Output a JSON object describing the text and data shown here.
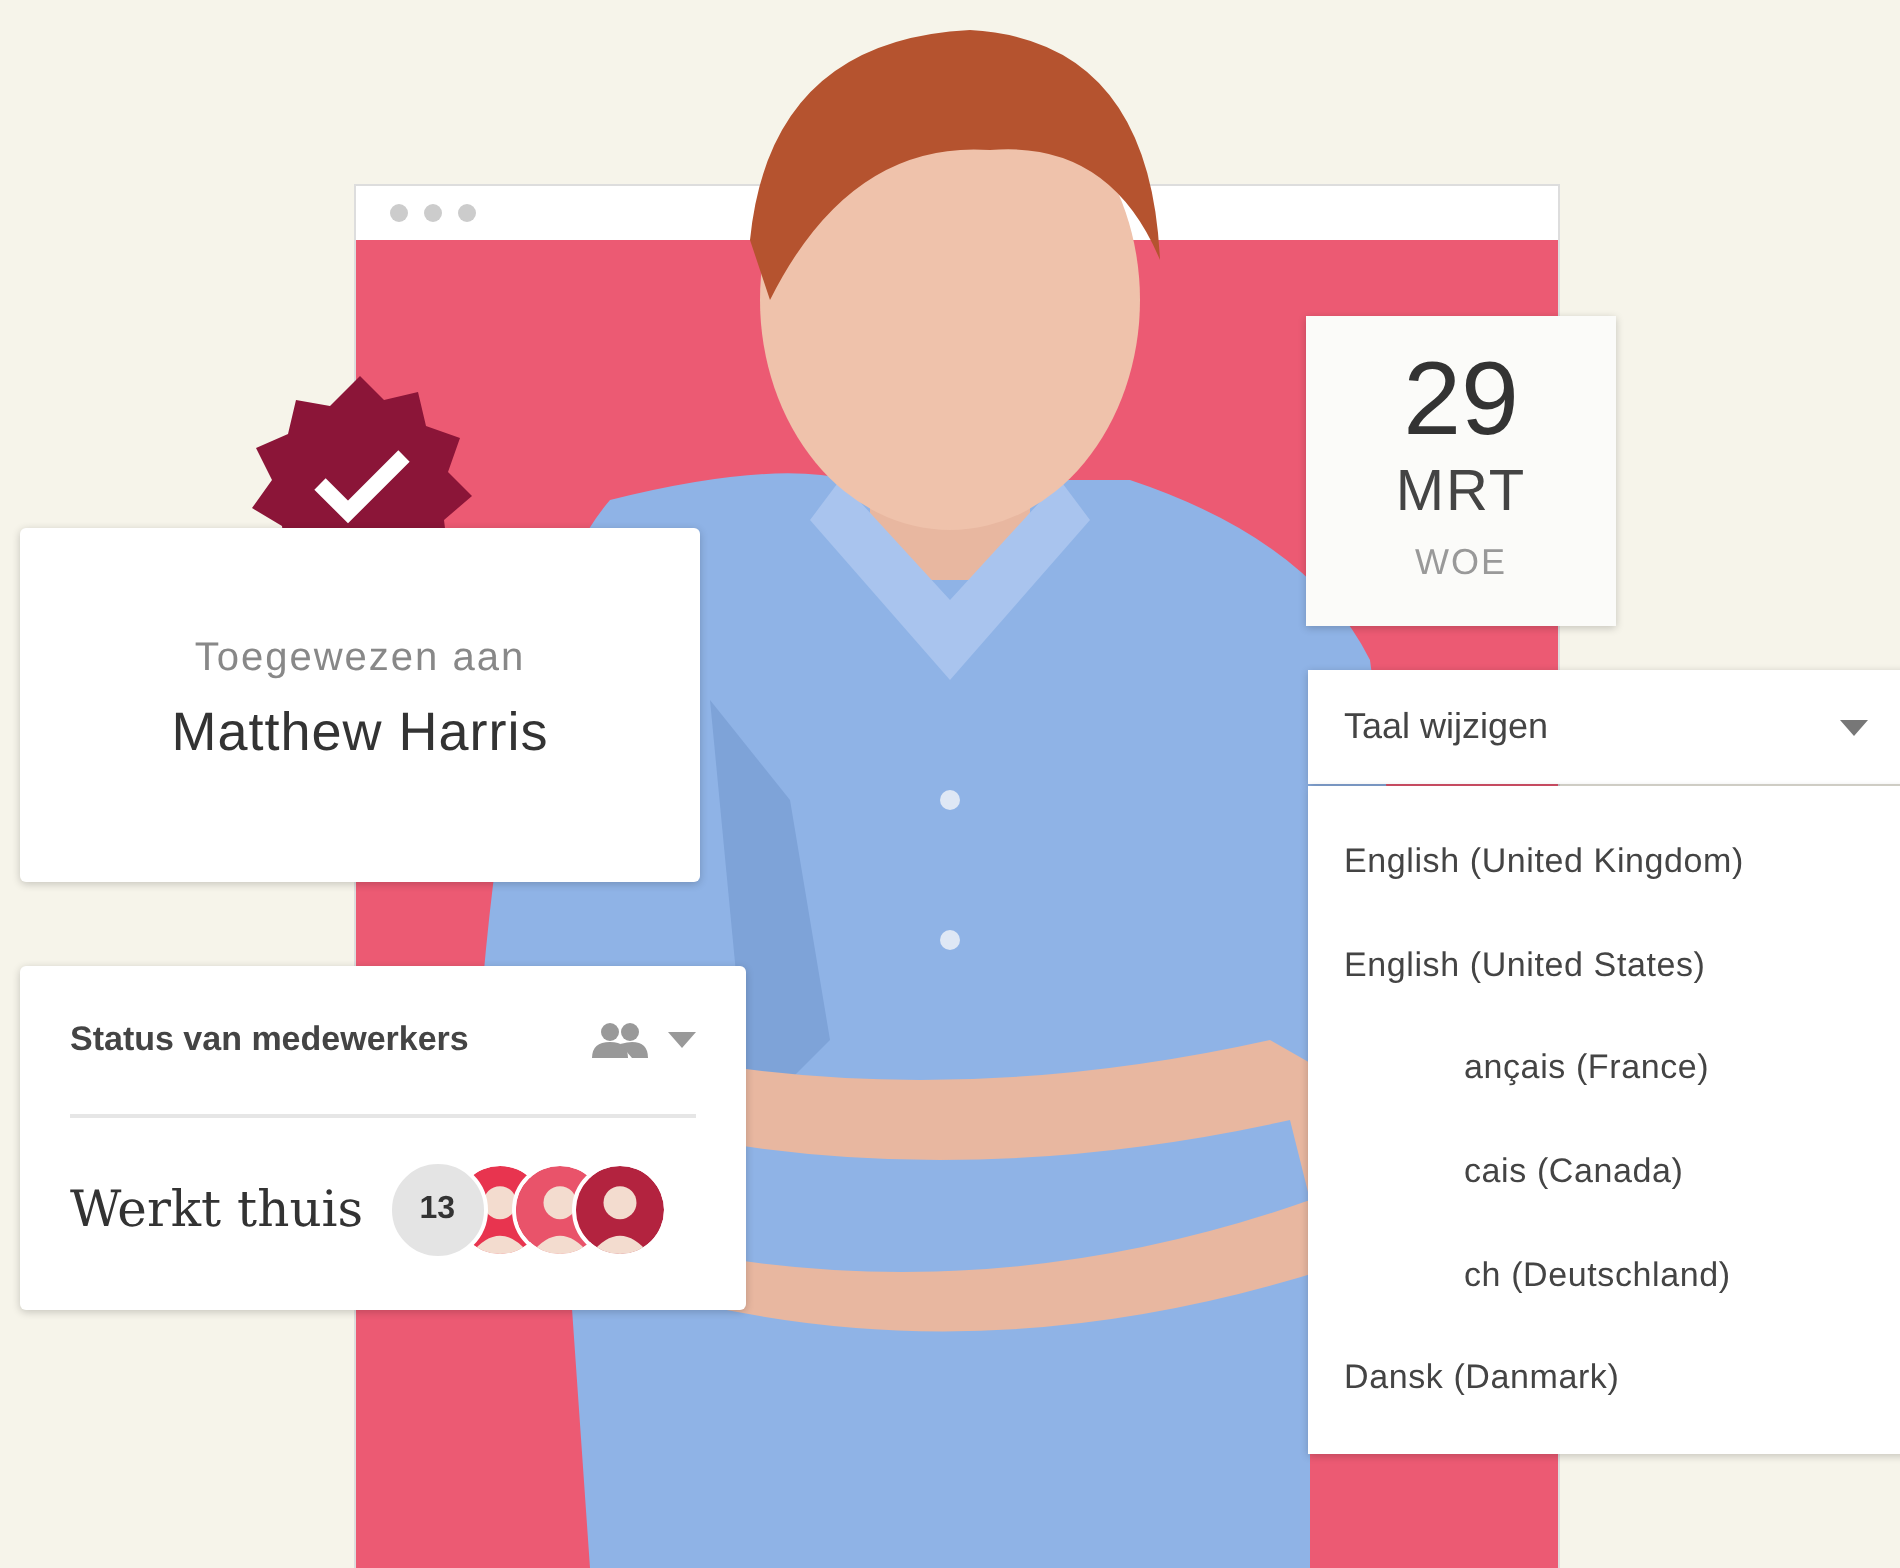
{
  "assignment": {
    "label": "Toegewezen aan",
    "name": "Matthew Harris"
  },
  "date": {
    "day": "29",
    "month": "MRT",
    "weekday": "WOE"
  },
  "language": {
    "label": "Taal wijzigen",
    "expanded": true,
    "options": [
      {
        "label": "English (United Kingdom)",
        "kind": "full"
      },
      {
        "label": "English (United States)",
        "kind": "full"
      },
      {
        "label": "ançais (France)",
        "kind": "partly_hidden"
      },
      {
        "label": "cais (Canada)",
        "kind": "partly_hidden"
      },
      {
        "label": "ch (Deutschland)",
        "kind": "partly_hidden"
      },
      {
        "label": "Dansk (Danmark)",
        "kind": "full"
      }
    ]
  },
  "staff_status": {
    "title": "Status van medewerkers",
    "status": "Werkt thuis",
    "count": "13",
    "avatars": [
      {
        "color": "#e8344f"
      },
      {
        "color": "#e9536a"
      },
      {
        "color": "#b3233f"
      }
    ]
  }
}
